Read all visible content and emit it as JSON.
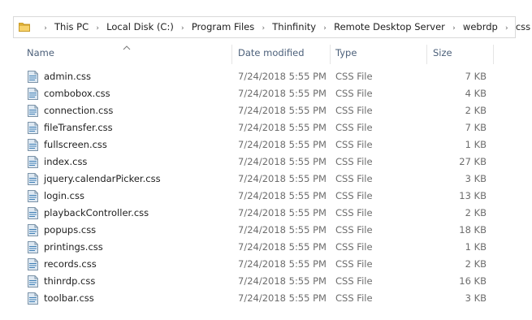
{
  "address": {
    "icon": "folder-icon",
    "path": [
      "This PC",
      "Local Disk (C:)",
      "Program Files",
      "Thinfinity",
      "Remote Desktop Server",
      "webrdp",
      "css"
    ]
  },
  "columns": {
    "name": "Name",
    "date": "Date modified",
    "type": "Type",
    "size": "Size",
    "sort_indicator": "sort-ascending-icon"
  },
  "files": [
    {
      "name": "admin.css",
      "date": "7/24/2018 5:55 PM",
      "type": "CSS File",
      "size": "7 KB"
    },
    {
      "name": "combobox.css",
      "date": "7/24/2018 5:55 PM",
      "type": "CSS File",
      "size": "4 KB"
    },
    {
      "name": "connection.css",
      "date": "7/24/2018 5:55 PM",
      "type": "CSS File",
      "size": "2 KB"
    },
    {
      "name": "fileTransfer.css",
      "date": "7/24/2018 5:55 PM",
      "type": "CSS File",
      "size": "7 KB"
    },
    {
      "name": "fullscreen.css",
      "date": "7/24/2018 5:55 PM",
      "type": "CSS File",
      "size": "1 KB"
    },
    {
      "name": "index.css",
      "date": "7/24/2018 5:55 PM",
      "type": "CSS File",
      "size": "27 KB"
    },
    {
      "name": "jquery.calendarPicker.css",
      "date": "7/24/2018 5:55 PM",
      "type": "CSS File",
      "size": "3 KB"
    },
    {
      "name": "login.css",
      "date": "7/24/2018 5:55 PM",
      "type": "CSS File",
      "size": "13 KB"
    },
    {
      "name": "playbackController.css",
      "date": "7/24/2018 5:55 PM",
      "type": "CSS File",
      "size": "2 KB"
    },
    {
      "name": "popups.css",
      "date": "7/24/2018 5:55 PM",
      "type": "CSS File",
      "size": "18 KB"
    },
    {
      "name": "printings.css",
      "date": "7/24/2018 5:55 PM",
      "type": "CSS File",
      "size": "1 KB"
    },
    {
      "name": "records.css",
      "date": "7/24/2018 5:55 PM",
      "type": "CSS File",
      "size": "2 KB"
    },
    {
      "name": "thinrdp.css",
      "date": "7/24/2018 5:55 PM",
      "type": "CSS File",
      "size": "16 KB"
    },
    {
      "name": "toolbar.css",
      "date": "7/24/2018 5:55 PM",
      "type": "CSS File",
      "size": "3 KB"
    }
  ],
  "file_icon": "css-file-icon",
  "colors": {
    "header_text": "#4c607a",
    "folder_yellow": "#e8b93a",
    "secondary_text": "#6d6d6d"
  }
}
